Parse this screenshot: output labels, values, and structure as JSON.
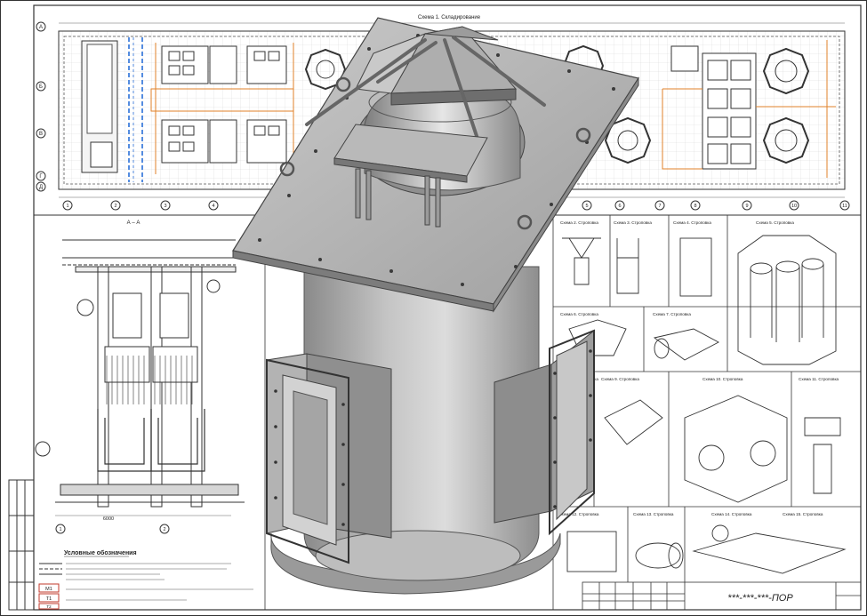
{
  "drawing": {
    "plan_title": "Схема 1. Складирование",
    "section_title": "А – А",
    "legend_title": "Условные обозначения",
    "stamp_code": "***-***-***-ПОР",
    "dimension": "6000",
    "axis_letters": [
      "А",
      "Б",
      "В",
      "Г",
      "Д"
    ],
    "axis_numbers": [
      "1",
      "2",
      "3",
      "4",
      "5",
      "6",
      "7",
      "8",
      "9",
      "10",
      "11"
    ],
    "section_axes": [
      "1",
      "2"
    ],
    "legend_codes": [
      "М1",
      "Т1",
      "Т2"
    ],
    "scheme_titles": [
      "Схема 2. Строповка",
      "Схема 3. Строповка",
      "Схема 4. Строповка",
      "Схема 5. Строповка",
      "Схема 6. Строповка",
      "Схема 7. Строповка",
      "Схема 8. Строповка",
      "Схема 9. Строповка",
      "Схема 10. Строповка",
      "Схема 11. Строповка",
      "Схема 12. Строповка",
      "Схема 13. Строповка",
      "Схема 14. Строповка",
      "Схема 15. Строповка"
    ]
  },
  "colors": {
    "line": "#333333",
    "orange": "#e0822a",
    "blue": "#2a6fd8",
    "model_light": "#c9c9c9",
    "model_mid": "#a9a9a9",
    "model_dark": "#7d7d7d"
  }
}
